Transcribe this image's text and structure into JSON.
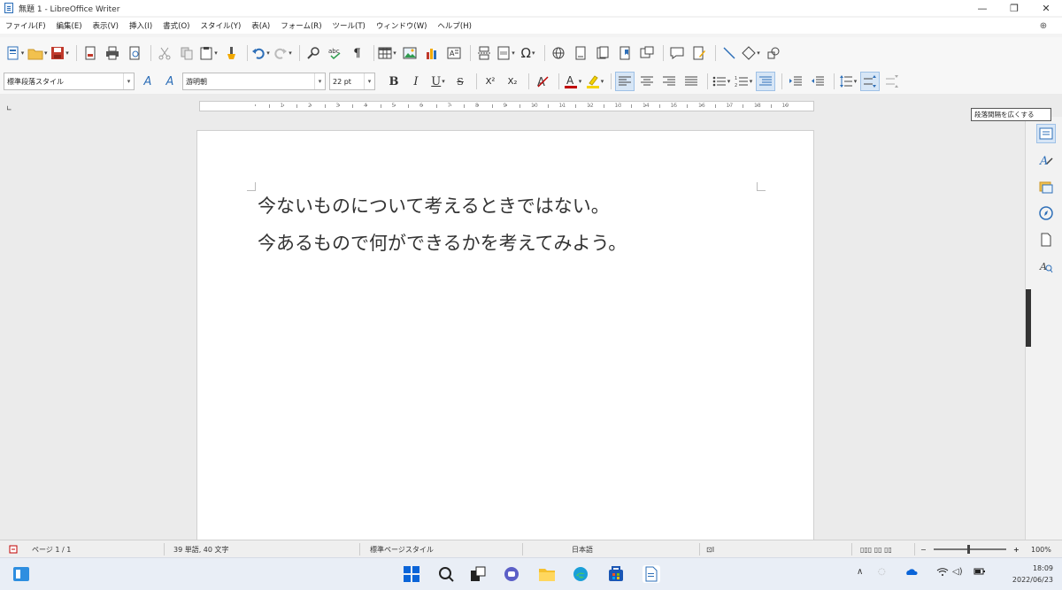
{
  "window": {
    "title": "無題 1 - LibreOffice Writer",
    "minimize": "—",
    "restore": "❐",
    "close": "✕"
  },
  "menu": [
    "ファイル(F)",
    "編集(E)",
    "表示(V)",
    "挿入(I)",
    "書式(O)",
    "スタイル(Y)",
    "表(A)",
    "フォーム(R)",
    "ツール(T)",
    "ウィンドウ(W)",
    "ヘルプ(H)"
  ],
  "format_bar": {
    "paragraph_style": "標準段落スタイル",
    "font_name": "游明朝",
    "font_size": "22 pt",
    "bold": "B",
    "italic": "I",
    "underline": "U",
    "strike": "S",
    "superscript": "X²",
    "subscript": "X₂"
  },
  "ruler": {
    "numbers": [
      "1",
      "2",
      "3",
      "4",
      "5",
      "6",
      "7",
      "8",
      "9",
      "10",
      "11",
      "12",
      "13",
      "14",
      "15",
      "16",
      "17",
      "18",
      "19"
    ]
  },
  "document": {
    "lines": [
      "今ないものについて考えるときではない。",
      "今あるもので何ができるかを考えてみよう。"
    ]
  },
  "tooltip": "段落間隔を広くする",
  "status": {
    "page": "ページ 1 / 1",
    "word_count": "39 単語, 40 文字",
    "page_style": "標準ページスタイル",
    "language": "日本語",
    "zoom_minus": "−",
    "zoom_plus": "+",
    "zoom": "100%"
  },
  "clock": {
    "time": "18:09",
    "date": "2022/06/23"
  },
  "colors": {
    "accent": "#2e6fb8",
    "highlight": "#f5d300",
    "font_color": "#c00000"
  }
}
